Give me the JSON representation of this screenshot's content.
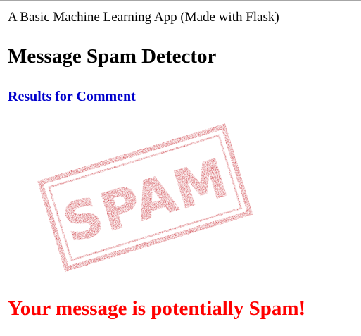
{
  "app": {
    "tagline": "A Basic Machine Learning App (Made with Flask)",
    "title": "Message Spam Detector"
  },
  "results": {
    "heading": "Results for Comment",
    "stamp_text": "SPAM",
    "verdict": "Your message is potentially Spam!"
  },
  "colors": {
    "heading_blue": "#0000cc",
    "verdict_red": "#ff0000",
    "stamp_red": "#c6262e"
  }
}
